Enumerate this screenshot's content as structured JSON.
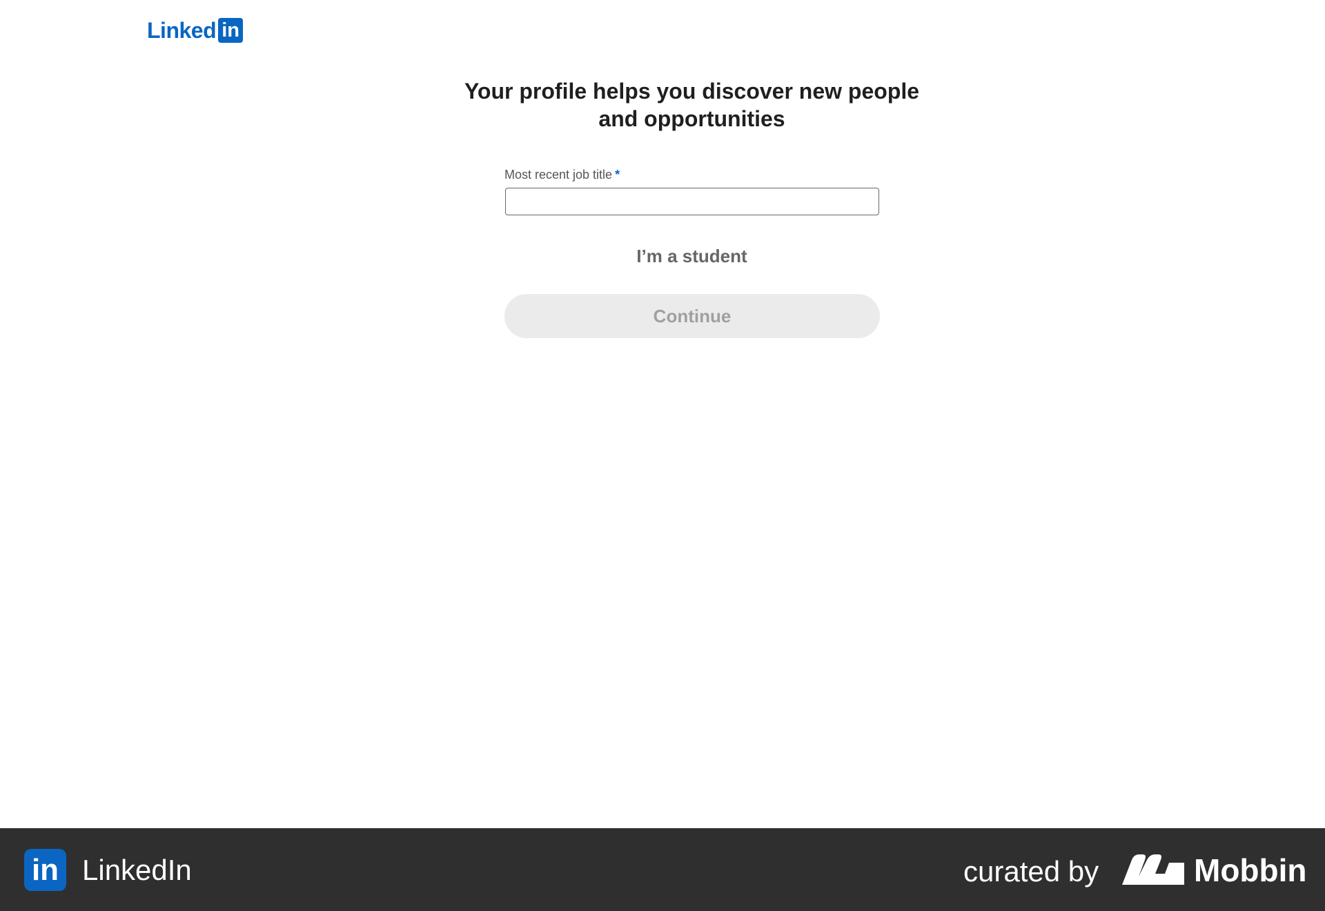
{
  "header": {
    "logo_word": "Linked",
    "logo_box": "in"
  },
  "main": {
    "heading": "Your profile helps you discover new people and opportunities",
    "job_title": {
      "label": "Most recent job title",
      "required_mark": "*",
      "value": "",
      "placeholder": ""
    },
    "student_link": "I’m a student",
    "continue_label": "Continue"
  },
  "footer": {
    "app_icon": "in",
    "app_name": "LinkedIn",
    "curated_by": "curated by",
    "brand": "Mobbin"
  },
  "icons": {
    "linkedin_logo": "linkedin-logo-icon",
    "mobbin_logo": "mobbin-logo-icon"
  },
  "colors": {
    "brand_blue": "#0a66c2",
    "footer_bg": "#2f2f2f",
    "button_disabled_bg": "#ebebeb",
    "button_disabled_text": "#a0a0a0"
  }
}
